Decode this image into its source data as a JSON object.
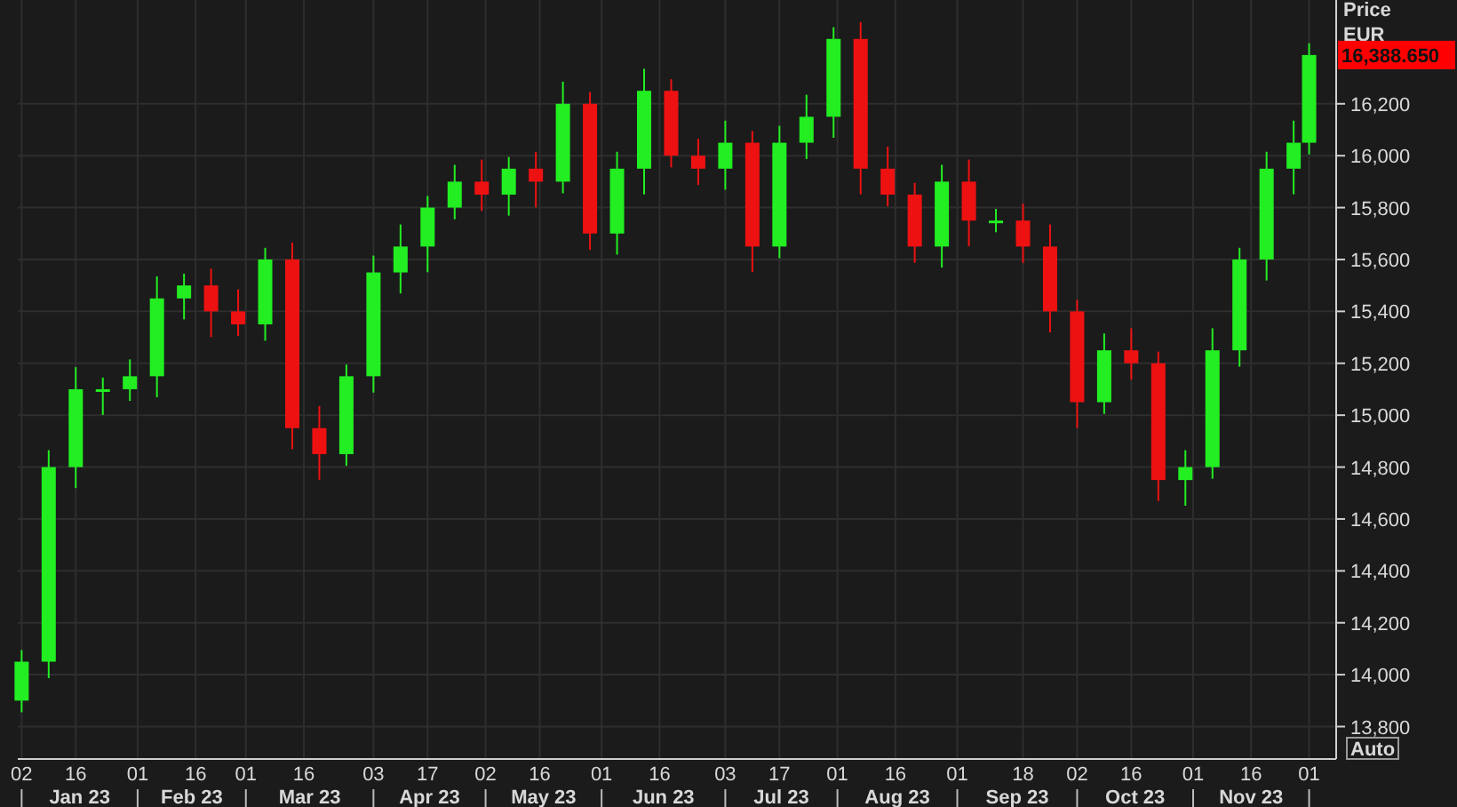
{
  "chart_data": {
    "type": "candlestick",
    "ylabel": "Price",
    "x": [
      "--01-02",
      "--01-09",
      "--01-16",
      "--01-23",
      "--01-30",
      "--02-06",
      "--02-13",
      "--02-20",
      "--02-27",
      "--03-06",
      "--03-13",
      "--03-20",
      "--03-27",
      "--04-03",
      "--04-10",
      "--04-17",
      "--04-24",
      "--05-01",
      "--05-08",
      "--05-15",
      "--05-22",
      "--05-29",
      "--06-05",
      "--06-12",
      "--06-19",
      "--06-26",
      "--07-03",
      "--07-10",
      "--07-17",
      "--07-24",
      "--07-31",
      "--08-07",
      "--08-14",
      "--08-21",
      "--08-28",
      "--09-04",
      "--09-11",
      "--09-18",
      "--09-25",
      "--10-02",
      "--10-09",
      "--10-16",
      "--10-23",
      "--10-30",
      "--11-06",
      "--11-13",
      "--11-20",
      "--11-27",
      "--12-01"
    ],
    "ohlc": [
      [
        13900,
        14095,
        13855,
        14050
      ],
      [
        14050,
        14865,
        13987,
        14800
      ],
      [
        14800,
        15185,
        14719,
        15100
      ],
      [
        15100,
        15145,
        15001,
        15100
      ],
      [
        15100,
        15215,
        15055,
        15150
      ],
      [
        15150,
        15535,
        15069,
        15450
      ],
      [
        15450,
        15545,
        15369,
        15500
      ],
      [
        15500,
        15565,
        15301,
        15400
      ],
      [
        15400,
        15485,
        15305,
        15350
      ],
      [
        15350,
        15645,
        15287,
        15600
      ],
      [
        15600,
        15665,
        14869,
        14950
      ],
      [
        14950,
        15035,
        14751,
        14850
      ],
      [
        14850,
        15195,
        14805,
        15150
      ],
      [
        15150,
        15615,
        15087,
        15550
      ],
      [
        15550,
        15735,
        15469,
        15650
      ],
      [
        15650,
        15845,
        15551,
        15800
      ],
      [
        15800,
        15965,
        15755,
        15900
      ],
      [
        15900,
        15985,
        15787,
        15850
      ],
      [
        15850,
        15995,
        15769,
        15950
      ],
      [
        15950,
        16015,
        15801,
        15900
      ],
      [
        15900,
        16285,
        15855,
        16200
      ],
      [
        16200,
        16245,
        15637,
        15700
      ],
      [
        15700,
        16015,
        15619,
        15950
      ],
      [
        15950,
        16335,
        15851,
        16250
      ],
      [
        16250,
        16295,
        15955,
        16000
      ],
      [
        16000,
        16065,
        15887,
        15950
      ],
      [
        15950,
        16135,
        15869,
        16050
      ],
      [
        16050,
        16095,
        15551,
        15650
      ],
      [
        15650,
        16115,
        15605,
        16050
      ],
      [
        16050,
        16235,
        15987,
        16150
      ],
      [
        16150,
        16495,
        16069,
        16450
      ],
      [
        16450,
        16515,
        15851,
        15950
      ],
      [
        15950,
        16035,
        15805,
        15850
      ],
      [
        15850,
        15895,
        15587,
        15650
      ],
      [
        15650,
        15965,
        15569,
        15900
      ],
      [
        15900,
        15985,
        15651,
        15750
      ],
      [
        15750,
        15795,
        15705,
        15750
      ],
      [
        15750,
        15815,
        15587,
        15650
      ],
      [
        15650,
        15735,
        15319,
        15400
      ],
      [
        15400,
        15445,
        14951,
        15050
      ],
      [
        15050,
        15315,
        15005,
        15250
      ],
      [
        15250,
        15335,
        15137,
        15200
      ],
      [
        15200,
        15245,
        14669,
        14750
      ],
      [
        14750,
        14865,
        14651,
        14800
      ],
      [
        14800,
        15335,
        14755,
        15250
      ],
      [
        15250,
        15645,
        15187,
        15600
      ],
      [
        15600,
        16015,
        15519,
        15950
      ],
      [
        15950,
        16135,
        15851,
        16050
      ],
      [
        16050,
        16433,
        16005,
        16388
      ]
    ],
    "xlim": [
      "--01-01",
      "--12-08"
    ],
    "ylim": [
      13675,
      16600
    ],
    "yticks": [
      {
        "value": 16200,
        "label": "16,200"
      },
      {
        "value": 16000,
        "label": "16,000"
      },
      {
        "value": 15800,
        "label": "15,800"
      },
      {
        "value": 15600,
        "label": "15,600"
      },
      {
        "value": 15400,
        "label": "15,400"
      },
      {
        "value": 15200,
        "label": "15,200"
      },
      {
        "value": 15000,
        "label": "15,000"
      },
      {
        "value": 14800,
        "label": "14,800"
      },
      {
        "value": 14600,
        "label": "14,600"
      },
      {
        "value": 14400,
        "label": "14,400"
      },
      {
        "value": 14200,
        "label": "14,200"
      },
      {
        "value": 14000,
        "label": "14,000"
      },
      {
        "value": 13800,
        "label": "13,800"
      }
    ],
    "xticks": [
      {
        "value": "--01-02",
        "label": "02"
      },
      {
        "value": "--01-16",
        "label": "16"
      },
      {
        "value": "--02-01",
        "label": "01"
      },
      {
        "value": "--02-16",
        "label": "16"
      },
      {
        "value": "--03-01",
        "label": "01"
      },
      {
        "value": "--03-16",
        "label": "16"
      },
      {
        "value": "--04-03",
        "label": "03"
      },
      {
        "value": "--04-17",
        "label": "17"
      },
      {
        "value": "--05-02",
        "label": "02"
      },
      {
        "value": "--05-16",
        "label": "16"
      },
      {
        "value": "--06-01",
        "label": "01"
      },
      {
        "value": "--06-16",
        "label": "16"
      },
      {
        "value": "--07-03",
        "label": "03"
      },
      {
        "value": "--07-17",
        "label": "17"
      },
      {
        "value": "--08-01",
        "label": "01"
      },
      {
        "value": "--08-16",
        "label": "16"
      },
      {
        "value": "--09-01",
        "label": "01"
      },
      {
        "value": "--09-18",
        "label": "18"
      },
      {
        "value": "--10-02",
        "label": "02"
      },
      {
        "value": "--10-16",
        "label": "16"
      },
      {
        "value": "--11-01",
        "label": "01"
      },
      {
        "value": "--11-16",
        "label": "16"
      },
      {
        "value": "--12-01",
        "label": "01"
      }
    ],
    "grid": true
  },
  "price_axis": {
    "unit": "EUR",
    "last_price": "16,388.650"
  },
  "time_axis": {
    "month_labels": [
      "Jan 23",
      "Feb 23",
      "Mar 23",
      "Apr 23",
      "May 23",
      "Jun 23",
      "Jul 23",
      "Aug 23",
      "Sep 23",
      "Oct 23",
      "Nov 23"
    ]
  },
  "scale_button": "Auto"
}
